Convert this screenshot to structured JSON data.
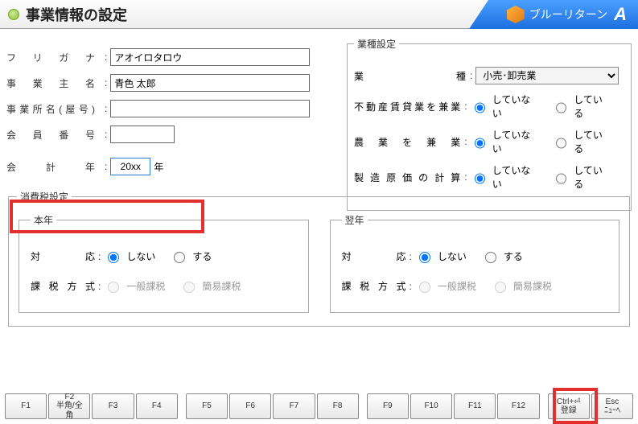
{
  "header": {
    "title": "事業情報の設定",
    "brand": "ブルーリターン",
    "brand_suffix": "A"
  },
  "form": {
    "furigana_label": "フ リ ガ ナ",
    "furigana_value": "アオイロタロウ",
    "owner_label": "事 業 主 名",
    "owner_value": "青色 太郎",
    "place_label": "事業所名(屋号)",
    "place_value": "",
    "member_label": "会 員 番 号",
    "member_value": "",
    "fy_label": "会　計　年",
    "fy_value": "20xx",
    "fy_suffix": "年"
  },
  "industry": {
    "legend": "業種設定",
    "type_label": "業　　　　　　種",
    "type_value": "小売･卸売業",
    "realestate_label": "不動産賃貸業を兼業",
    "agriculture_label": "農 業 を 兼 業",
    "mfgcost_label": "製 造 原 価 の 計 算",
    "opt_no": "していない",
    "opt_yes": "している",
    "realestate": "no",
    "agriculture": "no",
    "mfgcost": "no"
  },
  "tax": {
    "legend": "消費税設定",
    "this_year_legend": "本年",
    "next_year_legend": "翌年",
    "support_label": "対　応",
    "method_label": "課税方式",
    "opt_off": "しない",
    "opt_on": "する",
    "opt_general": "一般課税",
    "opt_simple": "簡易課税",
    "this_year_support": "off",
    "next_year_support": "off"
  },
  "fkeys": {
    "f1": {
      "k": "F1",
      "l": ""
    },
    "f2": {
      "k": "F2",
      "l": "半角/全角"
    },
    "f3": {
      "k": "F3",
      "l": ""
    },
    "f4": {
      "k": "F4",
      "l": ""
    },
    "f5": {
      "k": "F5",
      "l": ""
    },
    "f6": {
      "k": "F6",
      "l": ""
    },
    "f7": {
      "k": "F7",
      "l": ""
    },
    "f8": {
      "k": "F8",
      "l": ""
    },
    "f9": {
      "k": "F9",
      "l": ""
    },
    "f10": {
      "k": "F10",
      "l": ""
    },
    "f11": {
      "k": "F11",
      "l": ""
    },
    "f12": {
      "k": "F12",
      "l": ""
    },
    "submit": {
      "k": "Ctrl+⏎",
      "l": "登録"
    },
    "esc": {
      "k": "Esc",
      "l": "ﾆｭｰﾍ"
    }
  }
}
